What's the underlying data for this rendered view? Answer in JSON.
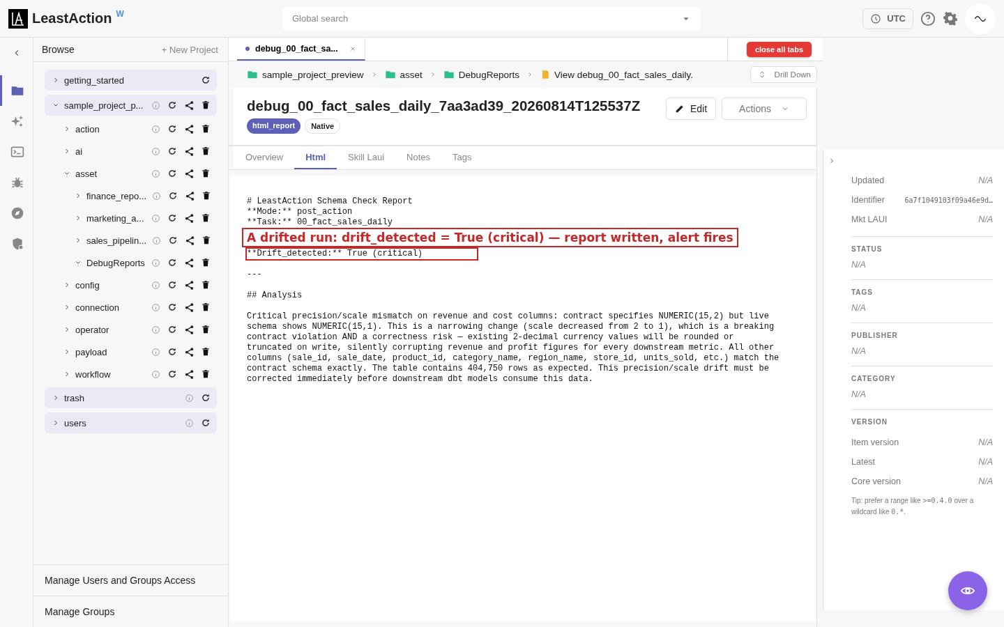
{
  "header": {
    "brand": "LeastAction",
    "brand_mark": "W",
    "search": {
      "placeholder": "Global search"
    },
    "timezone": "UTC"
  },
  "browse": {
    "title": "Browse",
    "new_project": "+ New Project",
    "tree": [
      {
        "label": "getting_started",
        "expanded": false,
        "kind": "root"
      },
      {
        "label": "sample_project_p...",
        "expanded": true,
        "kind": "project",
        "children": [
          {
            "label": "action",
            "expanded": false
          },
          {
            "label": "ai",
            "expanded": false
          },
          {
            "label": "asset",
            "expanded": true,
            "children": [
              {
                "label": "finance_repo...",
                "expanded": false
              },
              {
                "label": "marketing_a...",
                "expanded": false
              },
              {
                "label": "sales_pipelin...",
                "expanded": false
              },
              {
                "label": "DebugReports",
                "expanded": true
              }
            ]
          },
          {
            "label": "config",
            "expanded": false
          },
          {
            "label": "connection",
            "expanded": false
          },
          {
            "label": "operator",
            "expanded": false
          },
          {
            "label": "payload",
            "expanded": false
          },
          {
            "label": "workflow",
            "expanded": false
          }
        ]
      },
      {
        "label": "trash",
        "expanded": false,
        "kind": "system"
      },
      {
        "label": "users",
        "expanded": false,
        "kind": "system"
      }
    ],
    "links": [
      "Manage Users and Groups Access",
      "Manage Groups"
    ]
  },
  "rail": [
    {
      "kind": "folder",
      "selected": true
    },
    {
      "kind": "sparkle",
      "selected": false
    },
    {
      "kind": "terminal",
      "selected": false
    },
    {
      "kind": "bug",
      "selected": false
    },
    {
      "kind": "compass",
      "selected": false
    },
    {
      "kind": "shield",
      "selected": false
    }
  ],
  "open_tabs": [
    {
      "label": "debug_00_fact_sa...",
      "selected": true
    }
  ],
  "close_all": "close all tabs",
  "breadcrumb": [
    {
      "kind": "folder",
      "label": "sample_project_preview"
    },
    {
      "kind": "folder",
      "label": "asset"
    },
    {
      "kind": "folder",
      "label": "DebugReports"
    },
    {
      "kind": "file",
      "label": "View debug_00_fact_sales_daily."
    }
  ],
  "drill_down": "Drill Down",
  "document": {
    "title": "debug_00_fact_sales_daily_7aa3ad39_20260814T125537Z",
    "badges": [
      {
        "label": "html_report",
        "kind": "primary"
      },
      {
        "label": "Native",
        "kind": "outline"
      }
    ],
    "edit": "Edit",
    "actions": "Actions",
    "tabs": [
      {
        "label": "Overview",
        "selected": false
      },
      {
        "label": "Html",
        "selected": true
      },
      {
        "label": "Skill Laui",
        "selected": false
      },
      {
        "label": "Notes",
        "selected": false
      },
      {
        "label": "Tags",
        "selected": false
      }
    ],
    "report": [
      {
        "kind": "line",
        "text": "# LeastAction Schema Check Report"
      },
      {
        "kind": "line",
        "text": "**Mode:** post_action"
      },
      {
        "kind": "line",
        "text": "**Task:** 00_fact_sales_daily"
      },
      {
        "kind": "callout",
        "text": "A drifted run: drift_detected = True (critical) — report written, alert fires"
      },
      {
        "kind": "flagged",
        "text": "**Drift_detected:** True (critical)"
      },
      {
        "kind": "blank"
      },
      {
        "kind": "line",
        "text": "---"
      },
      {
        "kind": "blank"
      },
      {
        "kind": "line",
        "text": "## Analysis"
      },
      {
        "kind": "blank"
      },
      {
        "kind": "paragraph",
        "text": "Critical precision/scale mismatch on revenue and cost columns: contract specifies NUMERIC(15,2) but live schema shows NUMERIC(15,1). This is a narrowing change (scale decreased from 2 to 1), which is a breaking contract violation AND a correctness risk — existing 2-decimal currency values will be rounded or truncated on write, silently corrupting revenue and profit figures for every downstream metric. All other columns (sale_id, sale_date, product_id, category_name, region_name, store_id, units_sold, etc.) match the contract schema exactly. The table contains 404,750 rows as expected. This precision/scale drift must be corrected immediately before downstream dbt models consume this data."
      }
    ]
  },
  "details": {
    "fields": [
      {
        "label": "Updated",
        "value": "N/A",
        "kind": "empty"
      },
      {
        "label": "Identifier",
        "value": "6a7f1049103f09a46e9d…",
        "kind": "code"
      },
      {
        "label": "Mkt LAUI",
        "value": "N/A",
        "kind": "empty"
      }
    ],
    "sections": [
      {
        "title": "STATUS",
        "value": "N/A"
      },
      {
        "title": "TAGS",
        "value": "N/A"
      },
      {
        "title": "PUBLISHER",
        "value": "N/A"
      },
      {
        "title": "CATEGORY",
        "value": "N/A"
      }
    ],
    "version": {
      "title": "VERSION",
      "fields": [
        {
          "label": "Item version",
          "value": "N/A"
        },
        {
          "label": "Latest",
          "value": "N/A"
        },
        {
          "label": "Core version",
          "value": "N/A"
        }
      ],
      "tip": [
        {
          "kind": "text",
          "text": "Tip: prefer a range like "
        },
        {
          "kind": "code",
          "text": ">=0.4.0"
        },
        {
          "kind": "text",
          "text": " over a wildcard like "
        },
        {
          "kind": "code",
          "text": "0.*"
        },
        {
          "kind": "text",
          "text": "."
        }
      ]
    }
  }
}
